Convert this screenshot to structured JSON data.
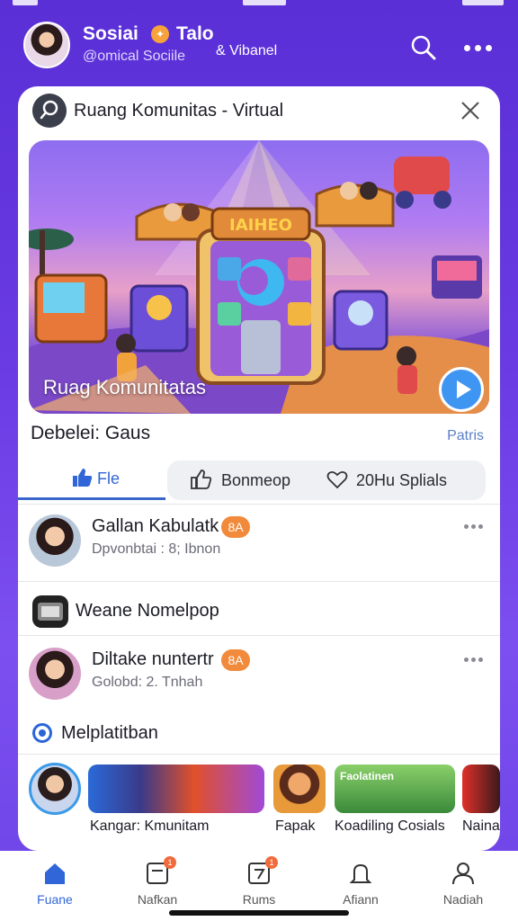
{
  "header": {
    "app_name": "Sosiai",
    "app_name_2": "Talo",
    "app_subtitle": "@omical Sociile",
    "app_subtitle_2": "& Vibanel"
  },
  "card": {
    "title": "Ruang Komunitas - Virtual",
    "hero": {
      "label": "Ruag Komunitatas",
      "sign_text": "IAIHEO"
    },
    "section_title": "Debelei: Gaus",
    "section_link": "Patris",
    "tabs": {
      "like_label": "Fle",
      "comment_label": "Bonmeop",
      "share_label": "20Hu Splials"
    },
    "posts": [
      {
        "name": "Gallan Kabulatk",
        "badge": "8A",
        "sub": "Dpvonbtai : 8; Ibnon"
      },
      {
        "name": "Diltake nuntertr",
        "badge": "8A",
        "sub": "Golobd: 2. Tnhah"
      }
    ],
    "row_item": {
      "label": "Weane Nomelpop"
    },
    "row_check": {
      "label": "Melplatitban"
    },
    "stories": [
      {
        "label": "Kangar: Kmunitam"
      },
      {
        "label": "Fapak"
      },
      {
        "label": "Koadiling Cosials"
      },
      {
        "label": "Naina"
      }
    ],
    "story_thumb_text": "Faolatinen"
  },
  "bottom_nav": [
    {
      "label": "Fuane",
      "icon": "home-icon",
      "active": true
    },
    {
      "label": "Nafkan",
      "icon": "chat-icon",
      "badge": "1"
    },
    {
      "label": "Rums",
      "icon": "box-icon",
      "badge": "1"
    },
    {
      "label": "Afiann",
      "icon": "bell-icon"
    },
    {
      "label": "Nadiah",
      "icon": "profile-icon"
    }
  ],
  "colors": {
    "brand_purple": "#5a2fd6",
    "accent_blue": "#3166d8",
    "badge_orange": "#f28a3b"
  }
}
